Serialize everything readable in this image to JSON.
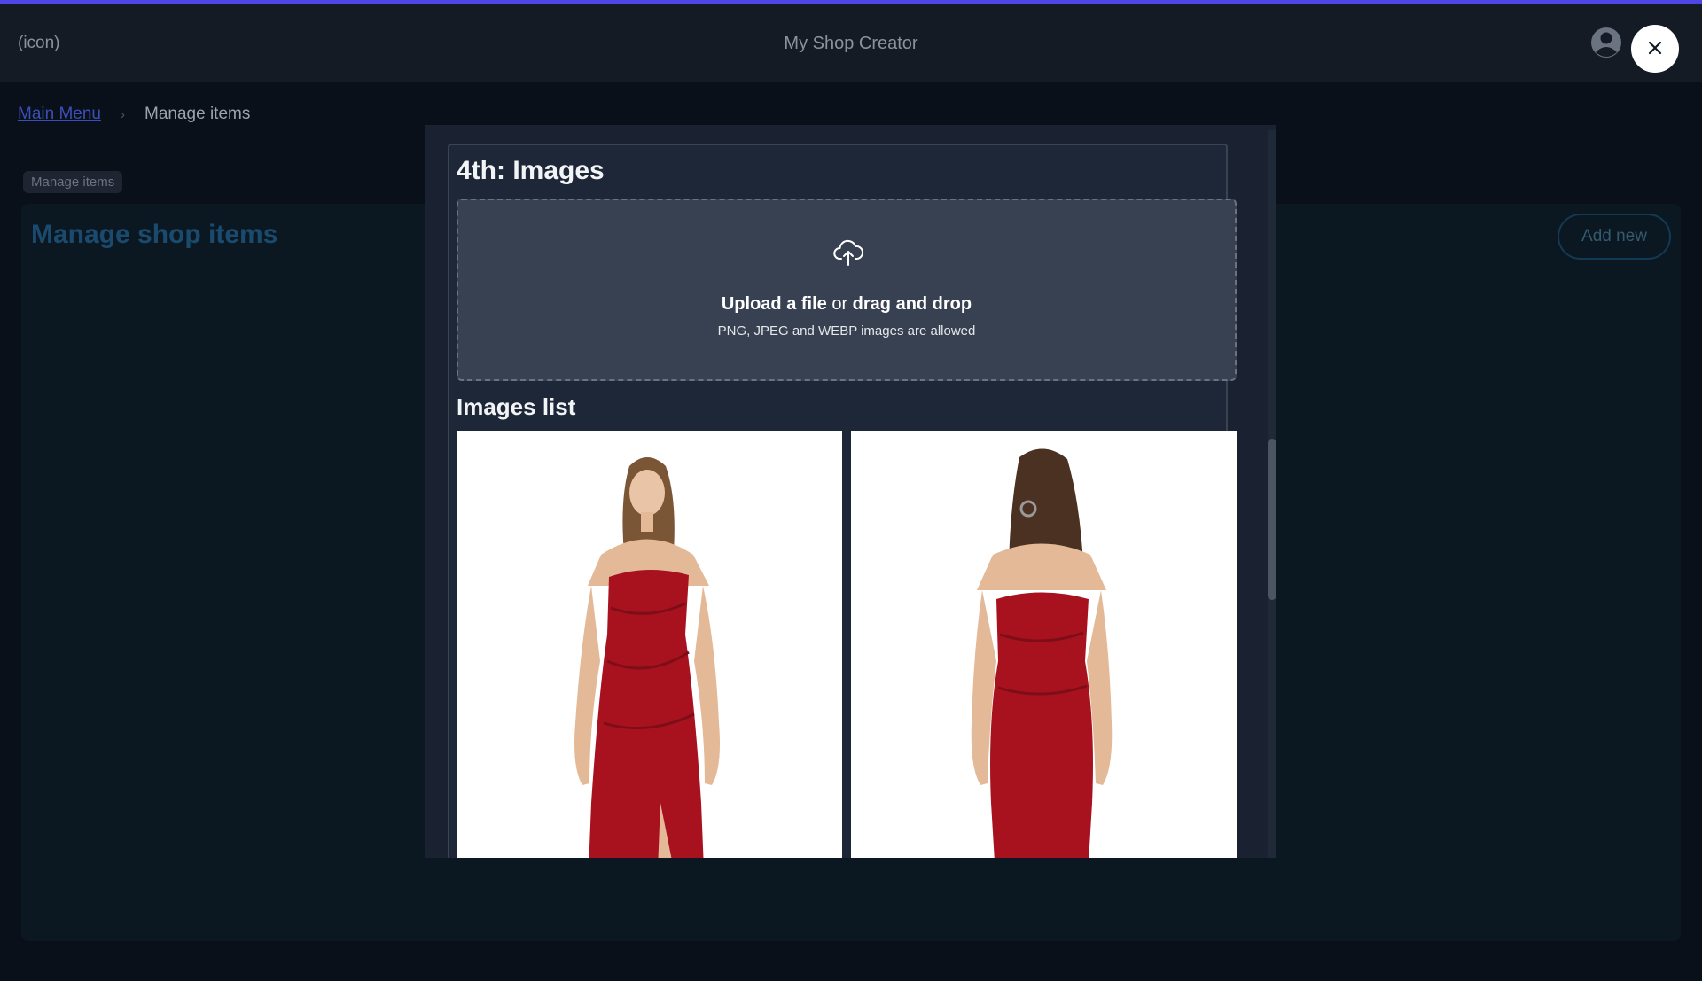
{
  "header": {
    "left_icon_text": "(icon)",
    "app_title": "My Shop Creator"
  },
  "breadcrumb": {
    "home_label": "Main Menu",
    "separator": "›",
    "current_label": "Manage items"
  },
  "page": {
    "tag_label": "Manage items",
    "title": "Manage shop items",
    "add_new_label": "Add new"
  },
  "modal": {
    "section_title": "4th: Images",
    "upload": {
      "link_text": "Upload a file",
      "or_text": " or ",
      "drag_text": "drag and drop",
      "hint": "PNG, JPEG and WEBP images are allowed"
    },
    "images_list_title": "Images list",
    "images": [
      {
        "view": "front",
        "dress_color": "#a8121f"
      },
      {
        "view": "back",
        "dress_color": "#a8121f"
      }
    ]
  },
  "colors": {
    "accent": "#4f46e5",
    "link": "#3b4fb8"
  }
}
